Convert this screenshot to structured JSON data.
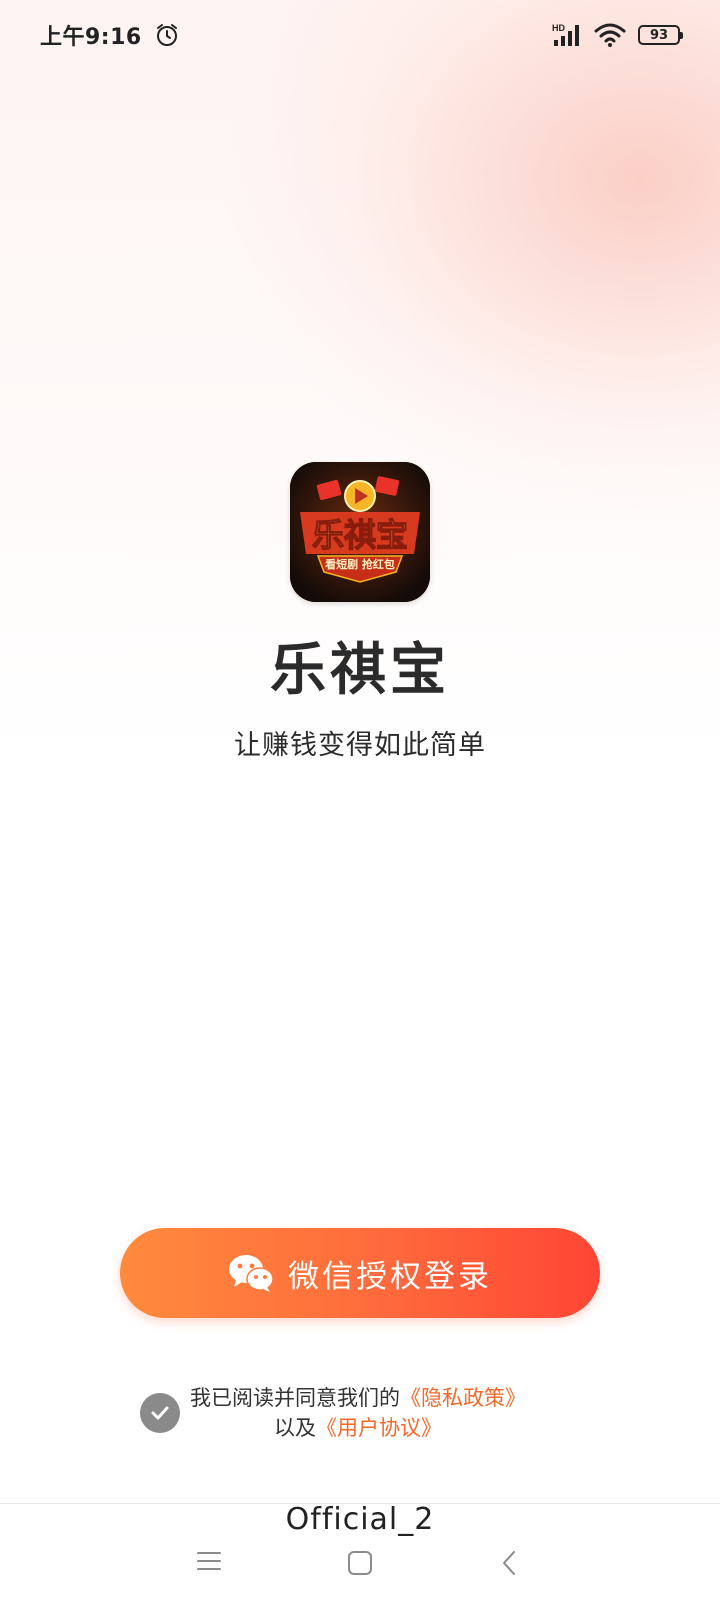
{
  "status_bar": {
    "time": "上午9:16",
    "network_label": "HD",
    "battery_level": "93"
  },
  "app": {
    "name": "乐祺宝",
    "slogan": "让赚钱变得如此简单",
    "logo": {
      "title": "乐祺宝",
      "banner": "看短剧 抢红包"
    }
  },
  "login": {
    "button_label": "微信授权登录",
    "icon": "wechat-icon"
  },
  "agreement": {
    "checked": true,
    "prefix": "我已阅读并同意我们的",
    "privacy_link": "《隐私政策》",
    "middle": "以及",
    "user_link": "《用户协议》"
  },
  "watermark": "Official_2",
  "nav": {
    "menu_icon": "menu-icon",
    "home_icon": "home-icon",
    "back_icon": "back-icon"
  },
  "colors": {
    "accent": "#ff6a3c",
    "link": "#f26a2a",
    "check": "#8a8a8a"
  }
}
